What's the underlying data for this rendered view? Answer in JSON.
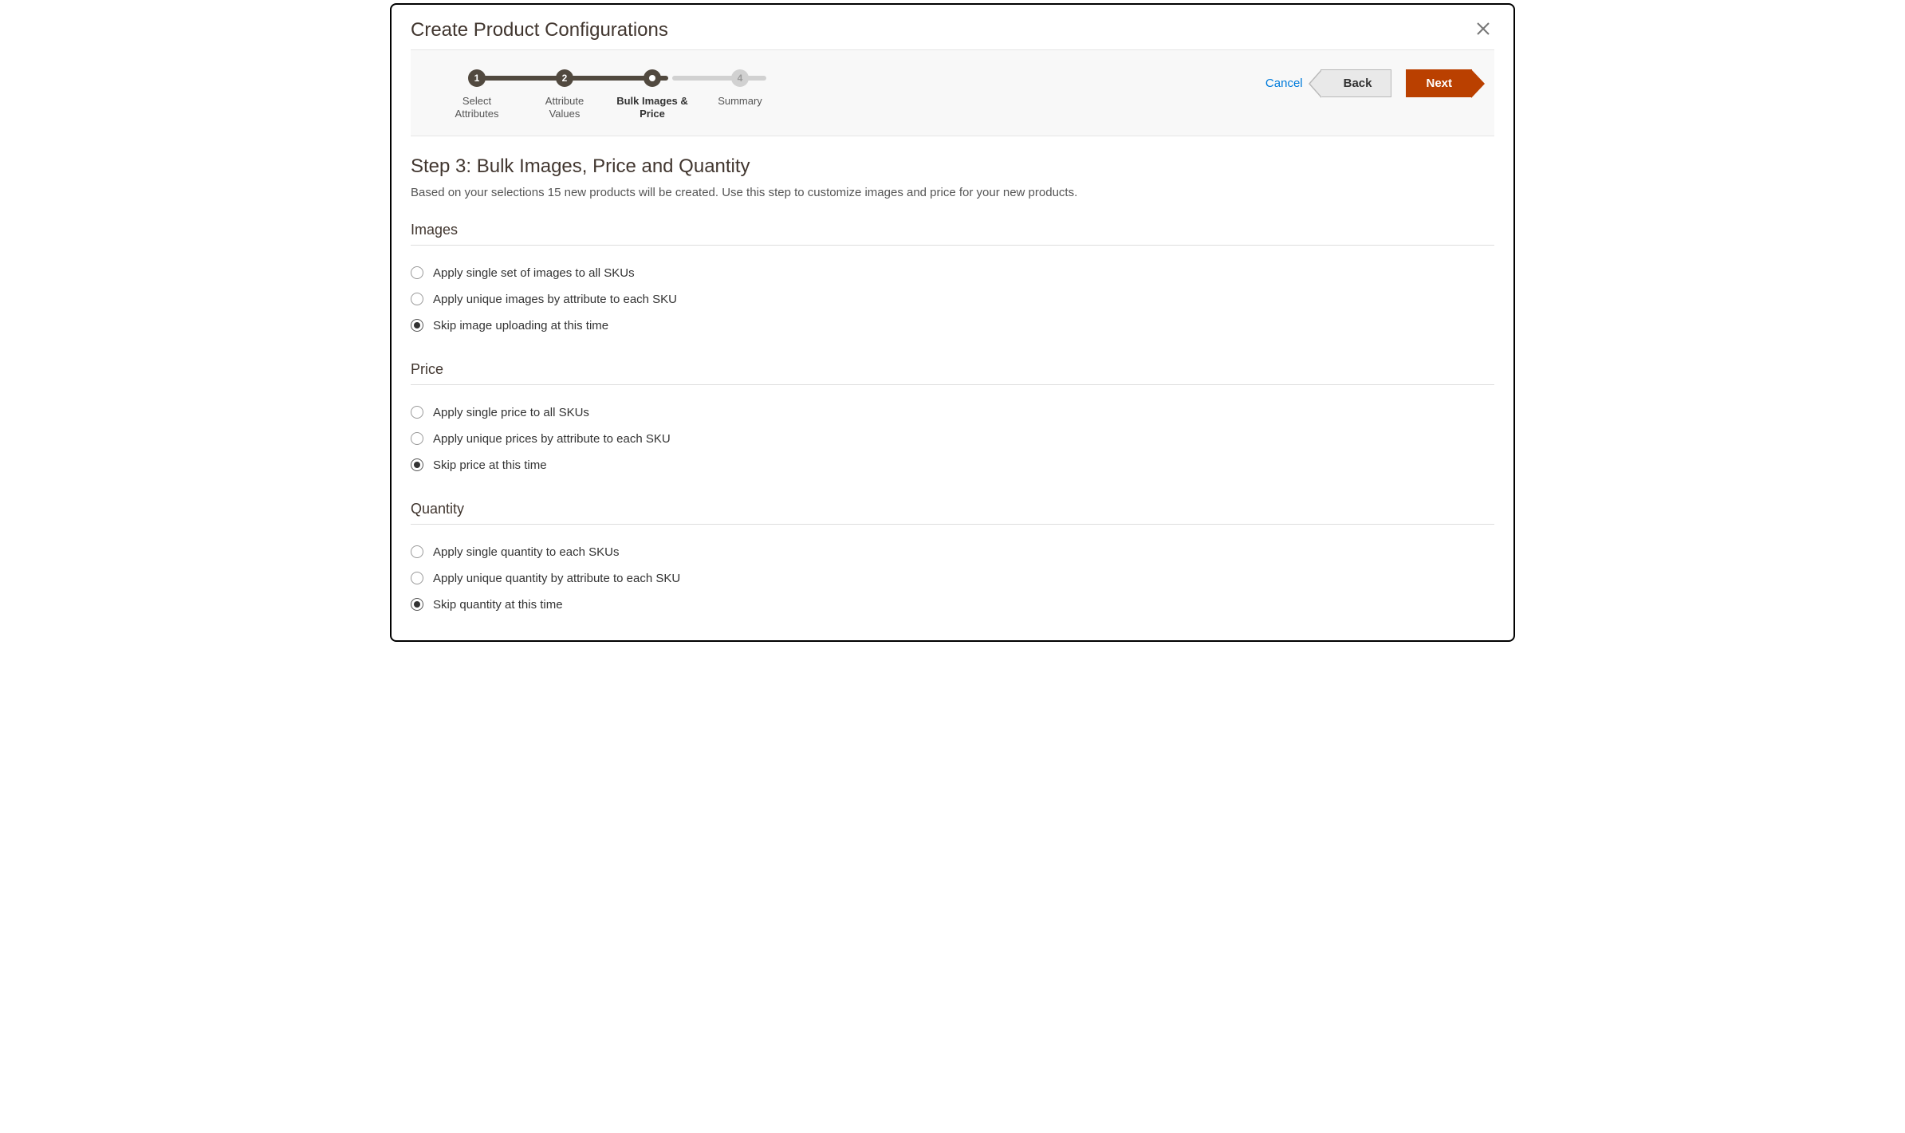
{
  "modal": {
    "title": "Create Product Configurations"
  },
  "stepper": {
    "steps": [
      {
        "num": "1",
        "label": "Select\nAttributes",
        "state": "done"
      },
      {
        "num": "2",
        "label": "Attribute\nValues",
        "state": "done"
      },
      {
        "num": "",
        "label": "Bulk Images &\nPrice",
        "state": "current"
      },
      {
        "num": "4",
        "label": "Summary",
        "state": "pending"
      }
    ]
  },
  "actions": {
    "cancel": "Cancel",
    "back": "Back",
    "next": "Next"
  },
  "stepContent": {
    "title": "Step 3: Bulk Images, Price and Quantity",
    "desc": "Based on your selections 15 new products will be created. Use this step to customize images and price for your new products."
  },
  "sections": {
    "images": {
      "title": "Images",
      "options": [
        {
          "label": "Apply single set of images to all SKUs",
          "selected": false
        },
        {
          "label": "Apply unique images by attribute to each SKU",
          "selected": false
        },
        {
          "label": "Skip image uploading at this time",
          "selected": true
        }
      ]
    },
    "price": {
      "title": "Price",
      "options": [
        {
          "label": "Apply single price to all SKUs",
          "selected": false
        },
        {
          "label": "Apply unique prices by attribute to each SKU",
          "selected": false
        },
        {
          "label": "Skip price at this time",
          "selected": true
        }
      ]
    },
    "quantity": {
      "title": "Quantity",
      "options": [
        {
          "label": "Apply single quantity to each SKUs",
          "selected": false
        },
        {
          "label": "Apply unique quantity by attribute to each SKU",
          "selected": false
        },
        {
          "label": "Skip quantity at this time",
          "selected": true
        }
      ]
    }
  }
}
